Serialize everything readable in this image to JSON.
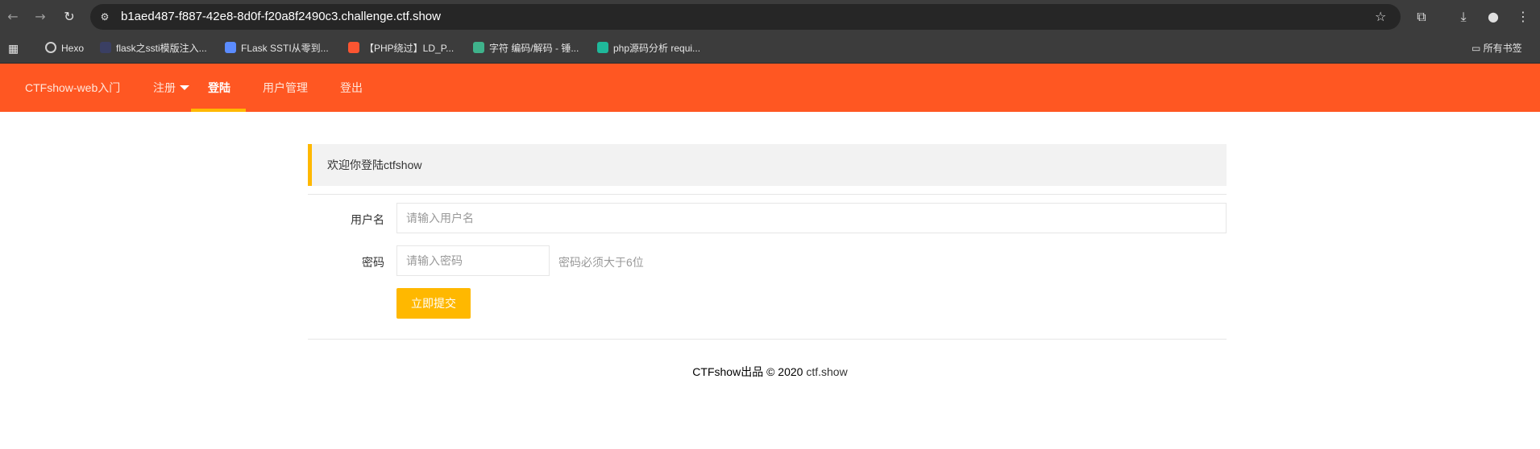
{
  "browser": {
    "url": "b1aed487-f887-42e8-8d0f-f20a8f2490c3.challenge.ctf.show",
    "bookmarks": [
      {
        "label": "Hexo",
        "icon": "globe-icon",
        "color": "#cfcfcf"
      },
      {
        "label": "flask之ssti模版注入...",
        "icon": "site-icon",
        "color": "#3a3f63"
      },
      {
        "label": "FLask SSTI从零到...",
        "icon": "csdn-icon",
        "color": "#5b8cff"
      },
      {
        "label": "【PHP绕过】LD_P...",
        "icon": "c-icon",
        "color": "#fc5531"
      },
      {
        "label": "字符 编码/解码 - 锤...",
        "icon": "t-icon",
        "color": "#3fb28b"
      },
      {
        "label": "php源码分析 requi...",
        "icon": "lock-icon",
        "color": "#1fb89a"
      }
    ],
    "all_bookmarks_label": "所有书签"
  },
  "navbar": {
    "brand": "CTFshow-web入门",
    "items": [
      "注册",
      "登陆",
      "用户管理",
      "登出"
    ],
    "active": "登陆",
    "accent": "#ff5722",
    "underline_color": "#ffb800"
  },
  "notice": {
    "text": "欢迎你登陆ctfshow"
  },
  "form": {
    "username_label": "用户名",
    "username_placeholder": "请输入用户名",
    "password_label": "密码",
    "password_placeholder": "请输入密码",
    "password_hint": "密码必须大于6位",
    "submit_label": "立即提交"
  },
  "footer": {
    "text": "CTFshow出品 © 2020",
    "link": "ctf.show"
  }
}
